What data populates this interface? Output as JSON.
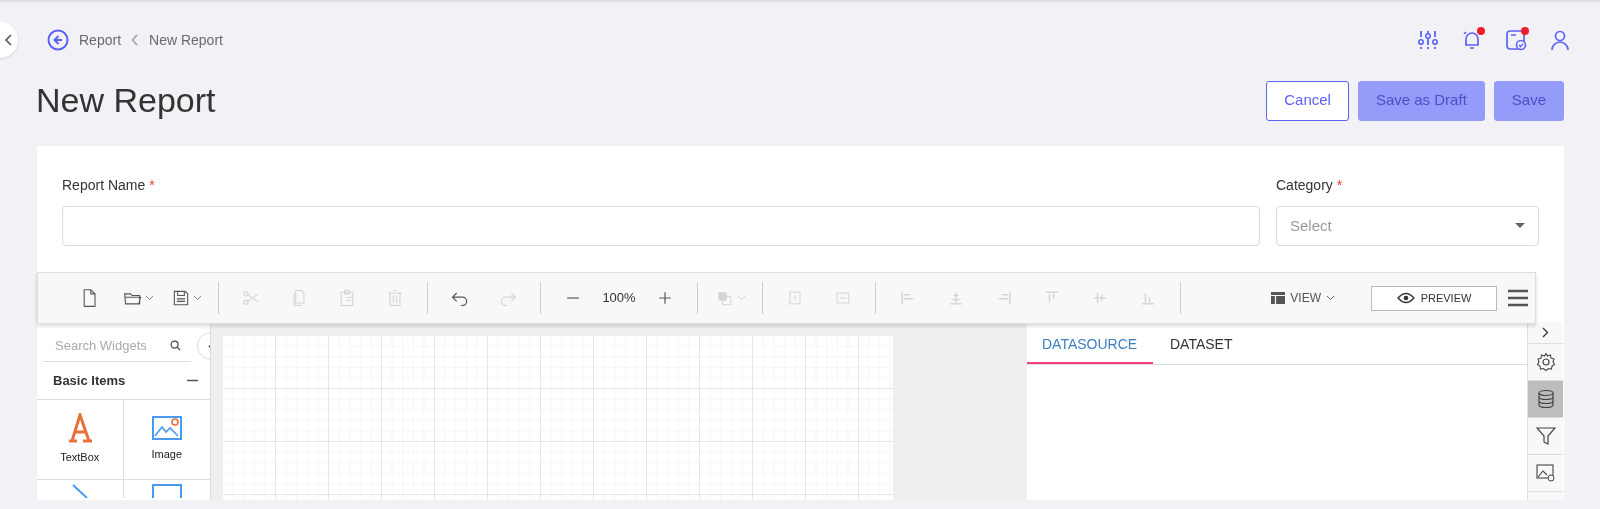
{
  "breadcrumb": [
    {
      "label": "Report"
    },
    {
      "label": "New Report"
    }
  ],
  "title": "New Report",
  "header_icons": [
    {
      "badge": false
    },
    {
      "badge": true
    },
    {
      "badge": true
    },
    {
      "badge": false
    }
  ],
  "actions": [
    {
      "label": "Cancel",
      "kind": "outline",
      "disabled": false
    },
    {
      "label": "Save as Draft",
      "kind": "filled",
      "disabled": true
    },
    {
      "label": "Save",
      "kind": "filled",
      "disabled": true
    }
  ],
  "form": {
    "fields": [
      {
        "label": "Report Name",
        "required_mark": "*",
        "kind": "text"
      },
      {
        "label": "Category",
        "required_mark": "*",
        "kind": "select",
        "placeholder": "Select"
      }
    ]
  },
  "designer": {
    "toolbar": {
      "groups": [
        [
          {
            "kind": "button",
            "disabled": false,
            "dropdown": false
          },
          {
            "kind": "button",
            "disabled": false,
            "dropdown": true
          },
          {
            "kind": "button",
            "disabled": false,
            "dropdown": true
          }
        ],
        [
          {
            "kind": "button",
            "disabled": true,
            "dropdown": false
          },
          {
            "kind": "button",
            "disabled": true,
            "dropdown": false
          },
          {
            "kind": "button",
            "disabled": true,
            "dropdown": false
          },
          {
            "kind": "button",
            "disabled": true,
            "dropdown": false
          }
        ],
        [
          {
            "kind": "button",
            "disabled": false,
            "dropdown": false
          },
          {
            "kind": "button",
            "disabled": true,
            "dropdown": false
          }
        ],
        [
          {
            "kind": "button",
            "disabled": false,
            "dropdown": false
          },
          {
            "kind": "zoom-level",
            "text": "100%"
          },
          {
            "kind": "button",
            "disabled": false,
            "dropdown": false
          }
        ],
        [
          {
            "kind": "button",
            "disabled": true,
            "dropdown": true
          }
        ],
        [
          {
            "kind": "button",
            "disabled": true,
            "dropdown": false
          },
          {
            "kind": "button",
            "disabled": true,
            "dropdown": false
          }
        ],
        [
          {
            "kind": "button",
            "disabled": true,
            "dropdown": false
          },
          {
            "kind": "button",
            "disabled": true,
            "dropdown": false
          },
          {
            "kind": "button",
            "disabled": true,
            "dropdown": false
          },
          {
            "kind": "button",
            "disabled": true,
            "dropdown": false
          },
          {
            "kind": "button",
            "disabled": true,
            "dropdown": false
          },
          {
            "kind": "button",
            "disabled": true,
            "dropdown": false
          }
        ]
      ],
      "view": {
        "label": "VIEW"
      },
      "preview": {
        "label": "PREVIEW"
      }
    },
    "widget_panel": {
      "search_placeholder": "Search Widgets",
      "section": {
        "title": "Basic Items",
        "expanded": true
      },
      "widgets": [
        "TextBox",
        "Image"
      ]
    },
    "data_panel": {
      "tabs": [
        {
          "label": "DATASOURCE",
          "selected": true
        },
        {
          "label": "DATASET",
          "selected": false
        }
      ]
    },
    "side_icons": [
      {
        "selected": false
      },
      {
        "selected": true
      },
      {
        "selected": false
      },
      {
        "selected": false
      }
    ]
  }
}
